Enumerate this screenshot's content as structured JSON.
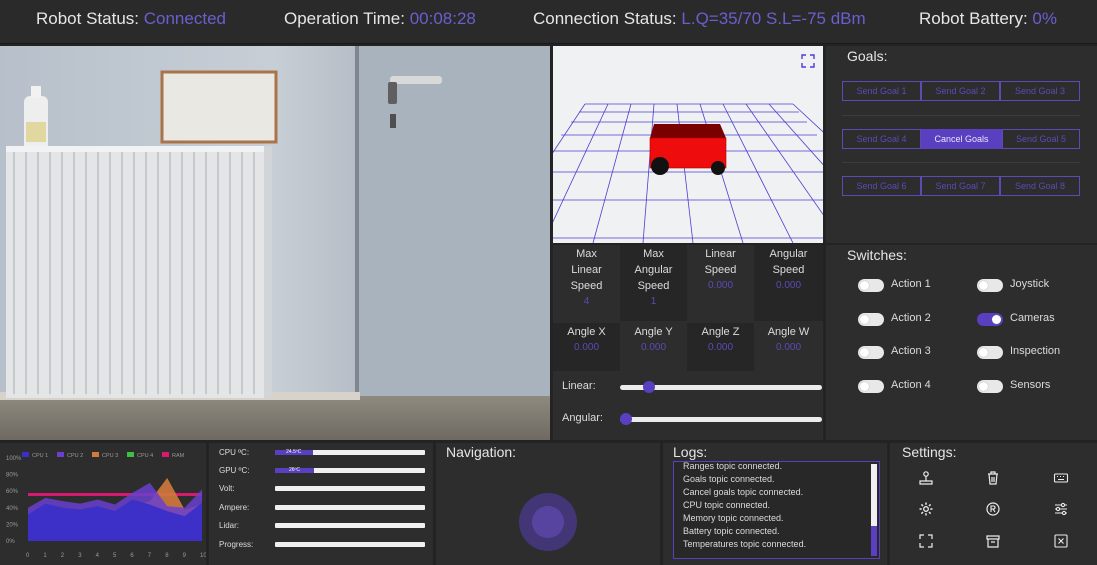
{
  "status_bar": {
    "robot_status_label": "Robot Status:",
    "robot_status_value": "Connected",
    "operation_time_label": "Operation Time:",
    "operation_time_value": "00:08:28",
    "connection_status_label": "Connection Status:",
    "connection_status_value": "L.Q=35/70 S.L=-75 dBm",
    "battery_label": "Robot Battery:",
    "battery_value": "0%"
  },
  "goals": {
    "title": "Goals:",
    "buttons": [
      "Send Goal 1",
      "Send Goal 2",
      "Send Goal 3",
      "Send Goal 4",
      "Cancel Goals",
      "Send Goal 5",
      "Send Goal 6",
      "Send Goal 7",
      "Send Goal 8"
    ]
  },
  "speeds": {
    "cells": [
      {
        "label": "Max\nLinear\nSpeed",
        "value": "4"
      },
      {
        "label": "Max\nAngular\nSpeed",
        "value": "1"
      },
      {
        "label": "Linear\nSpeed",
        "value": "0.000"
      },
      {
        "label": "Angular\nSpeed",
        "value": "0.000"
      },
      {
        "label": "Angle X",
        "value": "0.000"
      },
      {
        "label": "Angle Y",
        "value": "0.000"
      },
      {
        "label": "Angle Z",
        "value": "0.000"
      },
      {
        "label": "Angle W",
        "value": "0.000"
      }
    ],
    "linear_label": "Linear:",
    "angular_label": "Angular:",
    "linear_level": 0.12,
    "angular_level": 0.0
  },
  "switches": {
    "title": "Switches:",
    "items": [
      {
        "label": "Action 1",
        "on": false
      },
      {
        "label": "Joystick",
        "on": false
      },
      {
        "label": "Action 2",
        "on": false
      },
      {
        "label": "Cameras",
        "on": true
      },
      {
        "label": "Action 3",
        "on": false
      },
      {
        "label": "Inspection",
        "on": false
      },
      {
        "label": "Action 4",
        "on": false
      },
      {
        "label": "Sensors",
        "on": false
      }
    ]
  },
  "chart_data": {
    "type": "area",
    "legend": [
      "CPU 1",
      "CPU 2",
      "CPU 3",
      "CPU 4",
      "RAM"
    ],
    "colors": [
      "#3a2fc8",
      "#6a3fcf",
      "#d17a3c",
      "#3fbf3f",
      "#d61a6e"
    ],
    "x": [
      0,
      1,
      2,
      3,
      4,
      5,
      6,
      7,
      8,
      9,
      10
    ],
    "y_ticks": [
      "0%",
      "20%",
      "40%",
      "60%",
      "80%",
      "100%"
    ],
    "ylim": [
      0,
      100
    ],
    "series": [
      {
        "name": "CPU 1",
        "values": [
          32,
          45,
          40,
          38,
          42,
          36,
          50,
          44,
          36,
          30,
          46
        ]
      },
      {
        "name": "CPU 2",
        "values": [
          40,
          52,
          48,
          45,
          50,
          44,
          58,
          70,
          42,
          40,
          62
        ]
      },
      {
        "name": "CPU 3",
        "values": [
          30,
          35,
          38,
          34,
          40,
          36,
          42,
          48,
          76,
          38,
          44
        ]
      },
      {
        "name": "RAM",
        "values": [
          56,
          56,
          56,
          56,
          56,
          56,
          56,
          56,
          56,
          56,
          56
        ]
      }
    ]
  },
  "sensors": {
    "rows": [
      {
        "label": "CPU ºC:",
        "value": 0.25,
        "text": "24.5ºC"
      },
      {
        "label": "GPU ºC:",
        "value": 0.26,
        "text": "26ºC"
      },
      {
        "label": "Volt:",
        "value": 0,
        "text": ""
      },
      {
        "label": "Ampere:",
        "value": 0,
        "text": ""
      },
      {
        "label": "Lidar:",
        "value": 0,
        "text": ""
      },
      {
        "label": "Progress:",
        "value": 0,
        "text": ""
      }
    ]
  },
  "navigation": {
    "title": "Navigation:"
  },
  "logs": {
    "title": "Logs:",
    "lines": [
      "Ranges topic connected.",
      "Goals topic connected.",
      "Cancel goals topic connected.",
      "CPU topic connected.",
      "Memory topic connected.",
      "Battery topic connected.",
      "Temperatures topic connected."
    ]
  },
  "settings": {
    "title": "Settings:"
  }
}
